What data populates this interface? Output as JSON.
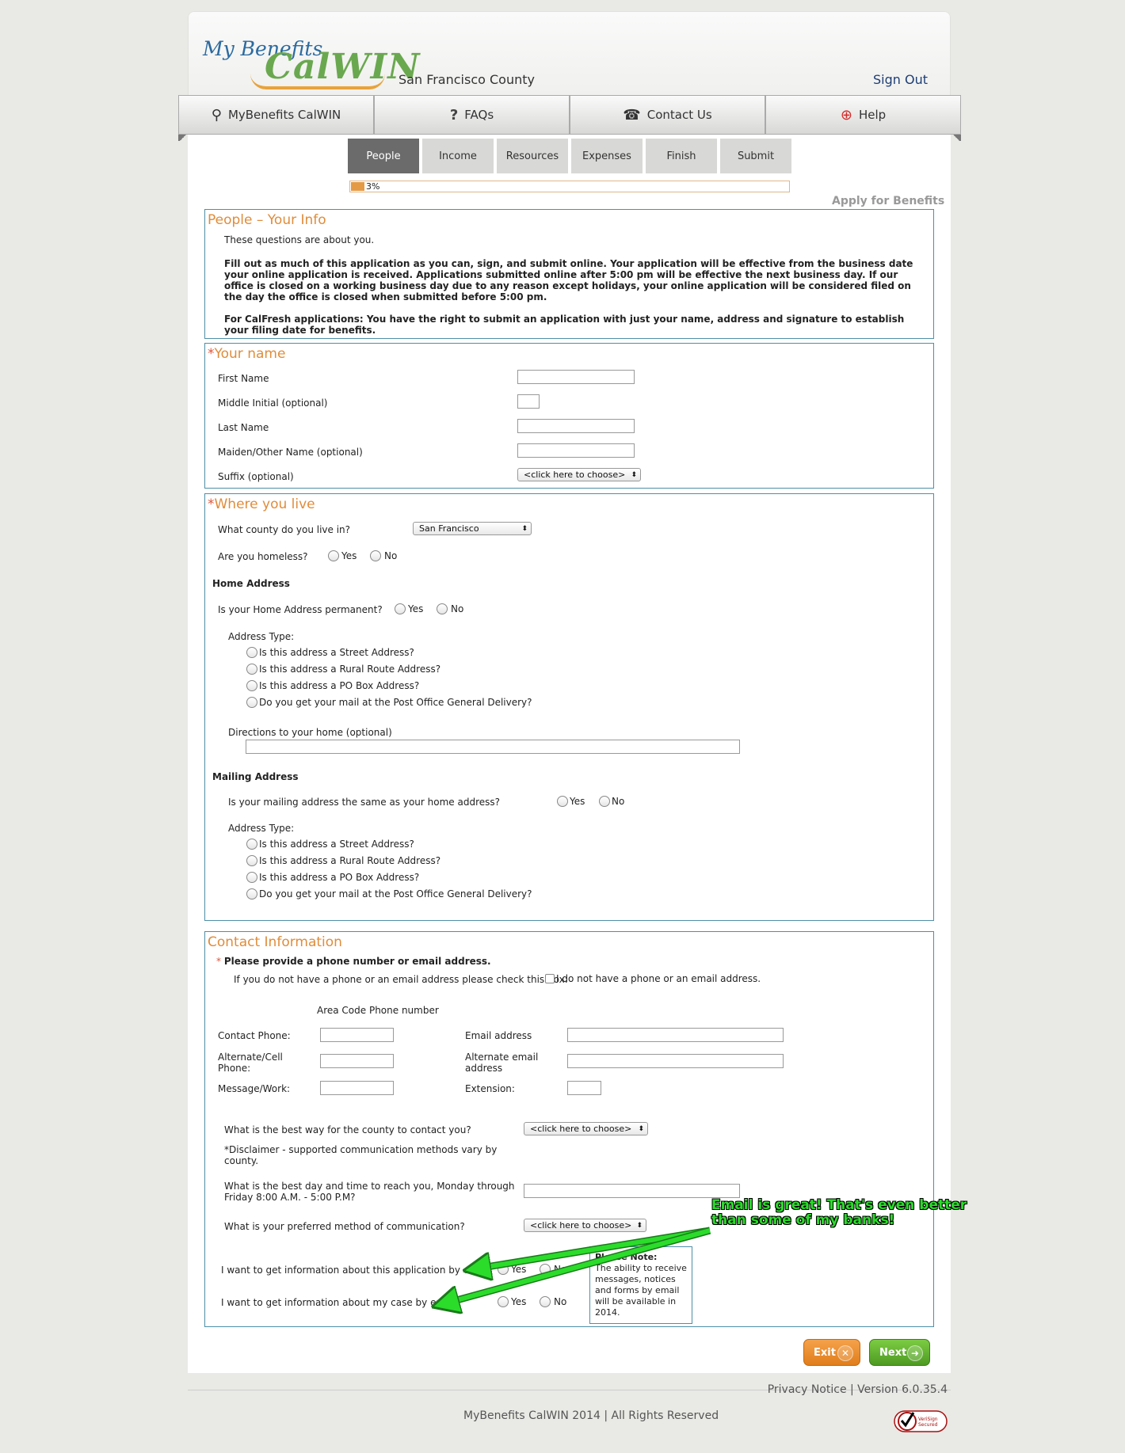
{
  "header": {
    "logo_my": "My Benefits",
    "logo_calwin": "CalWIN",
    "county": "San Francisco County",
    "sign_out": "Sign Out"
  },
  "nav": [
    {
      "label": "MyBenefits CalWIN",
      "icon": "search-icon"
    },
    {
      "label": "FAQs",
      "icon": "question-icon"
    },
    {
      "label": "Contact Us",
      "icon": "phone-icon"
    },
    {
      "label": "Help",
      "icon": "lifebuoy-icon"
    }
  ],
  "steps": [
    {
      "label": "People",
      "active": true
    },
    {
      "label": "Income",
      "active": false
    },
    {
      "label": "Resources",
      "active": false
    },
    {
      "label": "Expenses",
      "active": false
    },
    {
      "label": "Finish",
      "active": false
    },
    {
      "label": "Submit",
      "active": false
    }
  ],
  "progress": {
    "value": 0.03,
    "label": "3%"
  },
  "apply_link": "Apply for Benefits",
  "your_info": {
    "title": "People – Your Info",
    "intro": "These questions are about you.",
    "para1": "Fill out as much of this application as you can, sign, and submit online. Your application will be effective from the business date your online application is received. Applications submitted online after 5:00 pm will be effective the next business day. If our office is closed on a working business day due to any reason except holidays, your online application will be considered filed on the day the office is closed when submitted before 5:00 pm.",
    "para2": "For CalFresh applications: You have the right to submit an application with just your name, address and signature to establish your filing date for benefits."
  },
  "your_name": {
    "title": "Your name",
    "first_name": "First Name",
    "middle_initial": "Middle Initial (optional)",
    "last_name": "Last Name",
    "maiden": "Maiden/Other Name (optional)",
    "suffix": "Suffix (optional)",
    "suffix_value": "<click here to choose>"
  },
  "where_live": {
    "title": "Where you live",
    "county_q": "What county do you live in?",
    "county_value": "San Francisco",
    "homeless_q": "Are you homeless?",
    "yes": "Yes",
    "no": "No",
    "home_address": "Home Address",
    "permanent_q": "Is your Home Address permanent?",
    "address_type": "Address Type:",
    "types": [
      "Is this address a Street Address?",
      "Is this address a Rural Route Address?",
      "Is this address a PO Box Address?",
      "Do you get your mail at the Post Office General Delivery?"
    ],
    "directions": "Directions to your home (optional)",
    "mailing_address": "Mailing Address",
    "mailing_same_q": "Is your mailing address the same as your home address?"
  },
  "contact": {
    "title": "Contact Information",
    "provide": "Please provide a phone number or email address.",
    "no_phone_q": "If you do not have a phone or an email address please check this box:",
    "no_phone_label": "I do not have a phone or an email address.",
    "area_code_header": "Area Code Phone number",
    "contact_phone": "Contact Phone:",
    "alt_phone_1": "Alternate/Cell",
    "alt_phone_2": "Phone:",
    "message_work": "Message/Work:",
    "email": "Email address",
    "alt_email_1": "Alternate email",
    "alt_email_2": "address",
    "extension": "Extension:",
    "best_way_q": "What is the best way for the county to contact you?",
    "best_way_value": "<click here to choose>",
    "disclaimer_1": "*Disclaimer - supported communication methods vary by",
    "disclaimer_2": "county.",
    "best_time_1": "What is the best day and time to reach you, Monday through",
    "best_time_2": "Friday 8:00 A.M. - 5:00 P.M?",
    "preferred_q": "What is your preferred method of communication?",
    "preferred_value": "<click here to choose>",
    "info_app_q": "I want to get information about this application by email",
    "info_case_q": "I want to get information about my case by email",
    "yes": "Yes",
    "no": "No",
    "note_title": "Please Note:",
    "note_body": "The ability to receive messages, notices and forms by email will be available in 2014."
  },
  "buttons": {
    "exit": "Exit",
    "next": "Next"
  },
  "footer": {
    "privacy": "Privacy Notice | Version  6.0.35.4",
    "copyright": "MyBenefits CalWIN 2014 | All Rights Reserved",
    "verisign": "VeriSign Secured"
  },
  "annotation": {
    "line1": "Email is great! That's even better",
    "line2": "than some of my banks!",
    "color": "#2bdc2b"
  }
}
